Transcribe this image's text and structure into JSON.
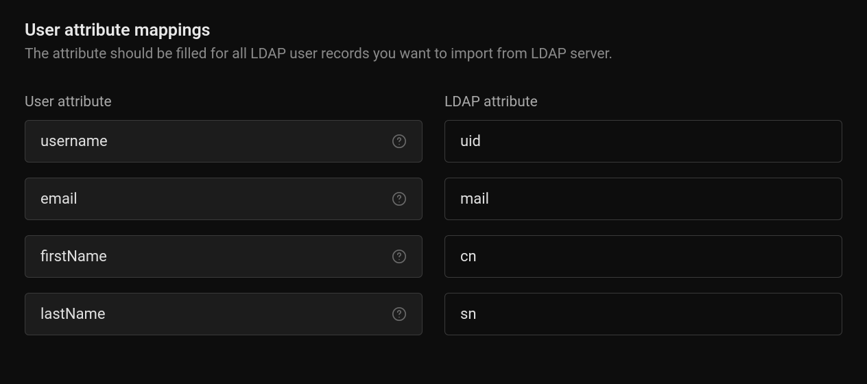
{
  "section": {
    "title": "User attribute mappings",
    "description": "The attribute should be filled for all LDAP user records you want to import from LDAP server."
  },
  "columns": {
    "user_attribute_header": "User attribute",
    "ldap_attribute_header": "LDAP attribute"
  },
  "mappings": [
    {
      "user_attribute": "username",
      "ldap_attribute": "uid"
    },
    {
      "user_attribute": "email",
      "ldap_attribute": "mail"
    },
    {
      "user_attribute": "firstName",
      "ldap_attribute": "cn"
    },
    {
      "user_attribute": "lastName",
      "ldap_attribute": "sn"
    }
  ]
}
